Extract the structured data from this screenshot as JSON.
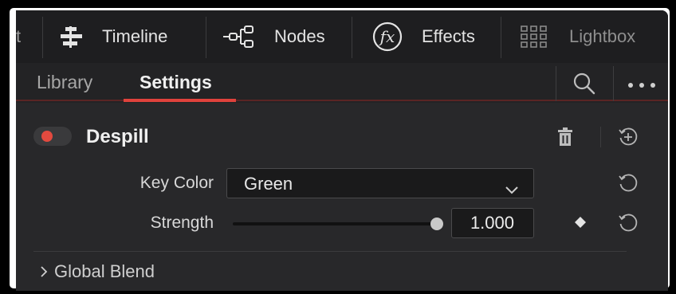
{
  "toolbar": {
    "partial_label": "t",
    "items": [
      {
        "label": "Timeline",
        "icon": "timeline-icon"
      },
      {
        "label": "Nodes",
        "icon": "nodes-icon"
      },
      {
        "label": "Effects",
        "icon": "fx-icon"
      },
      {
        "label": "Lightbox",
        "icon": "grid-icon"
      }
    ]
  },
  "tabs": {
    "items": [
      "Library",
      "Settings"
    ],
    "active": "Settings",
    "actions": [
      "search-icon",
      "more-icon"
    ]
  },
  "effect": {
    "title": "Despill",
    "enabled": true,
    "actions": [
      "trash-icon",
      "add-preset-icon"
    ]
  },
  "properties": {
    "key_color": {
      "label": "Key Color",
      "value": "Green"
    },
    "strength": {
      "label": "Strength",
      "value": "1.000",
      "slider_fraction": 1.0
    }
  },
  "sections": {
    "global_blend": {
      "label": "Global Blend",
      "expanded": false
    }
  },
  "colors": {
    "panel_bg": "#28282a",
    "toolbar_bg": "#1e1e20",
    "accent_red": "#e0423c",
    "text": "#e4e4e4"
  }
}
